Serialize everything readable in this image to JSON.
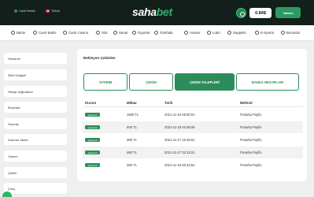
{
  "header": {
    "canli_destek": "Canlı Destek",
    "language": "Türkçe",
    "logo_main": "saha",
    "logo_accent": "bet",
    "balance": "0.84$",
    "deposit_label": "Yatırım"
  },
  "nav": {
    "items": [
      "Bahis",
      "Canlı Bahis",
      "Canlı Casino",
      "Slot",
      "Sanal",
      "Oyunlar",
      "Tombala",
      "Aviator",
      "Lotto",
      "Zeppelin",
      "E-Sports",
      "Bonuslar"
    ]
  },
  "sidebar": {
    "items": [
      "Hesabım",
      "Şifre Değiştir",
      "Hesap doğrulama",
      "Bonuslar",
      "Geçmiş",
      "Aranma Talebi",
      "Yatırım",
      "Çekim",
      "Çıkış"
    ]
  },
  "main": {
    "title": "Bekleyen Çekimler",
    "tabs": [
      "YATIRIM",
      "ÇEKİM",
      "ÇEKİM TALEPLERİ",
      "BANKA HESAPLARI"
    ],
    "active_tab": 2,
    "table": {
      "headers": [
        "Durum",
        "Miktar",
        "Tarih",
        "Method"
      ],
      "rows": [
        {
          "status": "approved",
          "amount": "1600 TL",
          "date": "2021-11-24 06:00:01",
          "method": "Fixturka Payfix"
        },
        {
          "status": "approved",
          "amount": "600 TL",
          "date": "2021-11-18 02:06:09",
          "method": "Fixturka Payfix"
        },
        {
          "status": "approved",
          "amount": "360 TL",
          "date": "2021-11-17 16:26:51",
          "method": "Fixturka Payfix"
        },
        {
          "status": "approved",
          "amount": "460 TL",
          "date": "2021-11-17 03:13:21",
          "method": "Fixturka Payfix"
        },
        {
          "status": "approved",
          "amount": "460 TL",
          "date": "2021-11-16 00:23:52",
          "method": "Fixturka Payfix"
        }
      ]
    }
  },
  "colors": {
    "brand_green": "#2e8b5c",
    "topbar_bg": "#131f1a"
  }
}
